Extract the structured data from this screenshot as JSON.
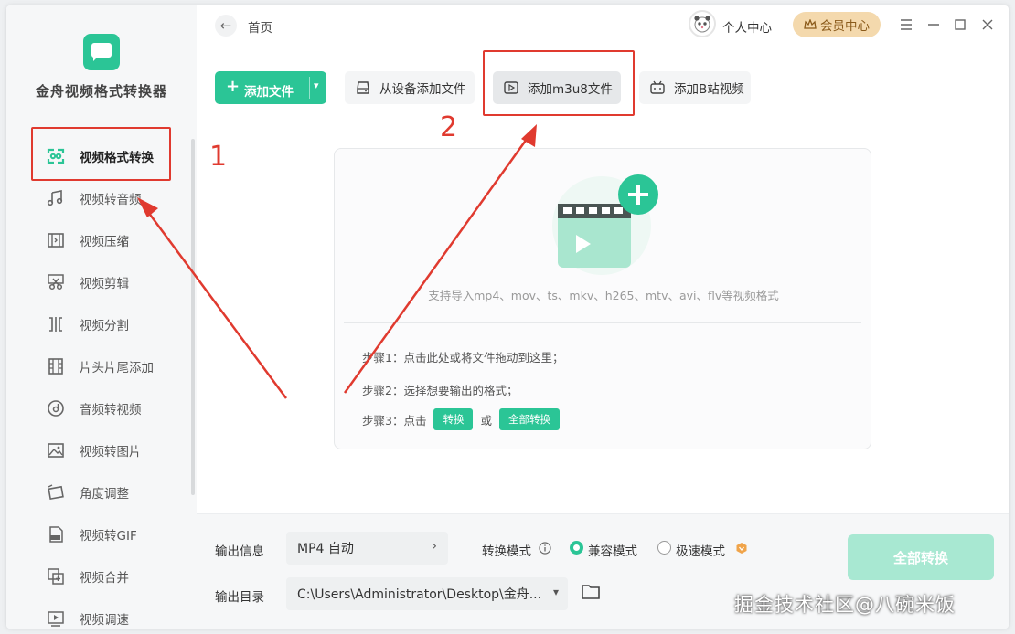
{
  "app": {
    "name": "金舟视频格式转换器",
    "accent": "#2bc596",
    "annotation_color": "#e03a2f"
  },
  "sidebar": {
    "items": [
      {
        "label": "视频格式转换",
        "icon": "video-convert-icon",
        "active": true
      },
      {
        "label": "视频转音频",
        "icon": "music-note-icon"
      },
      {
        "label": "视频压缩",
        "icon": "compress-icon"
      },
      {
        "label": "视频剪辑",
        "icon": "scissors-icon"
      },
      {
        "label": "视频分割",
        "icon": "split-icon"
      },
      {
        "label": "片头片尾添加",
        "icon": "film-strip-icon"
      },
      {
        "label": "音频转视频",
        "icon": "music-disc-icon"
      },
      {
        "label": "视频转图片",
        "icon": "image-icon"
      },
      {
        "label": "角度调整",
        "icon": "rotate-icon"
      },
      {
        "label": "视频转GIF",
        "icon": "gif-icon"
      },
      {
        "label": "视频合并",
        "icon": "merge-icon"
      },
      {
        "label": "视频调速",
        "icon": "speed-icon"
      }
    ]
  },
  "header": {
    "breadcrumb": "首页",
    "personal_center": "个人中心",
    "vip_center": "会员中心"
  },
  "toolbar": {
    "add_file": "添加文件",
    "add_from_device": "从设备添加文件",
    "add_m3u8": "添加m3u8文件",
    "add_bilibili": "添加B站视频"
  },
  "annotations": {
    "label_1": "1",
    "label_2": "2"
  },
  "dropzone": {
    "hint": "支持导入mp4、mov、ts、mkv、h265、mtv、avi、flv等视频格式",
    "step1": "步骤1：点击此处或将文件拖动到这里；",
    "step2": "步骤2：选择想要输出的格式；",
    "step3_prefix": "步骤3：点击",
    "step3_btn1": "转换",
    "step3_or": "或",
    "step3_btn2": "全部转换"
  },
  "bottom": {
    "output_info_label": "输出信息",
    "format_value": "MP4 自动",
    "convert_mode_label": "转换模式",
    "mode_compatible": "兼容模式",
    "mode_fast": "极速模式",
    "selected_mode": "兼容模式",
    "output_dir_label": "输出目录",
    "output_dir_value": "C:\\Users\\Administrator\\Desktop\\金舟...",
    "convert_all": "全部转换"
  },
  "watermark": "掘金技术社区@八碗米饭"
}
